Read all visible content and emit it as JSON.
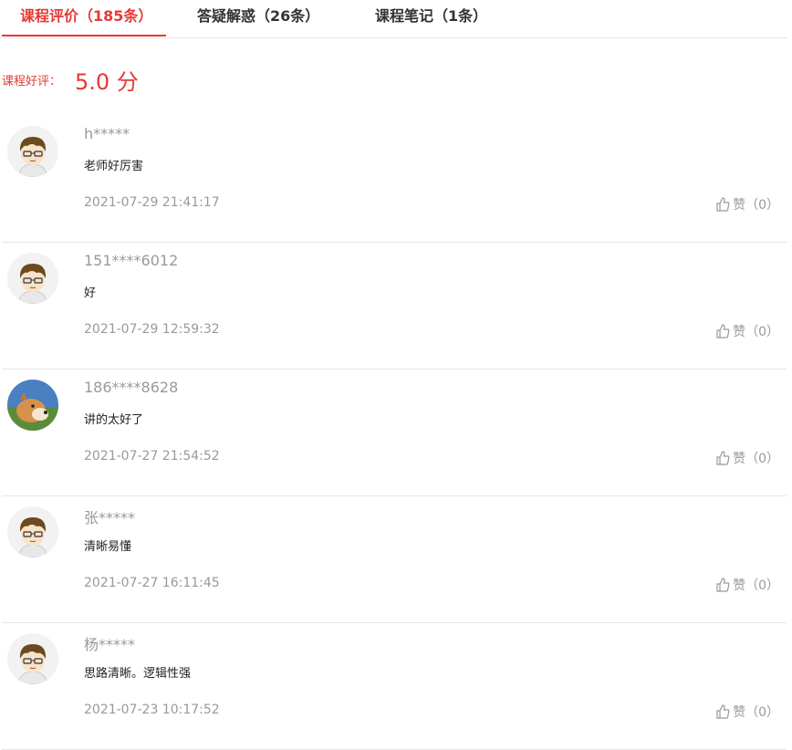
{
  "tabs": [
    {
      "label": "课程评价（185条）",
      "active": true
    },
    {
      "label": "答疑解惑（26条）",
      "active": false
    },
    {
      "label": "课程笔记（1条）",
      "active": false
    }
  ],
  "rating": {
    "label": "课程好评：",
    "score": "5.0 分"
  },
  "reviews": [
    {
      "user": "h*****",
      "content": "老师好厉害",
      "time": "2021-07-29 21:41:17",
      "like_label": "赞",
      "like_count": "（0）",
      "avatar": "boy-cartoon-avatar"
    },
    {
      "user": "151****6012",
      "content": "好",
      "time": "2021-07-29 12:59:32",
      "like_label": "赞",
      "like_count": "（0）",
      "avatar": "boy-cartoon-avatar"
    },
    {
      "user": "186****8628",
      "content": "讲的太好了",
      "time": "2021-07-27 21:54:52",
      "like_label": "赞",
      "like_count": "（0）",
      "avatar": "dog-photo-avatar"
    },
    {
      "user": "张*****",
      "content": "清晰易懂",
      "time": "2021-07-27 16:11:45",
      "like_label": "赞",
      "like_count": "（0）",
      "avatar": "boy-cartoon-avatar"
    },
    {
      "user": "杨*****",
      "content": "思路清晰。逻辑性强",
      "time": "2021-07-23 10:17:52",
      "like_label": "赞",
      "like_count": "（0）",
      "avatar": "boy-cartoon-avatar"
    }
  ],
  "colors": {
    "accent": "#e53935",
    "muted": "#999999",
    "divider": "#e6e6e6"
  }
}
